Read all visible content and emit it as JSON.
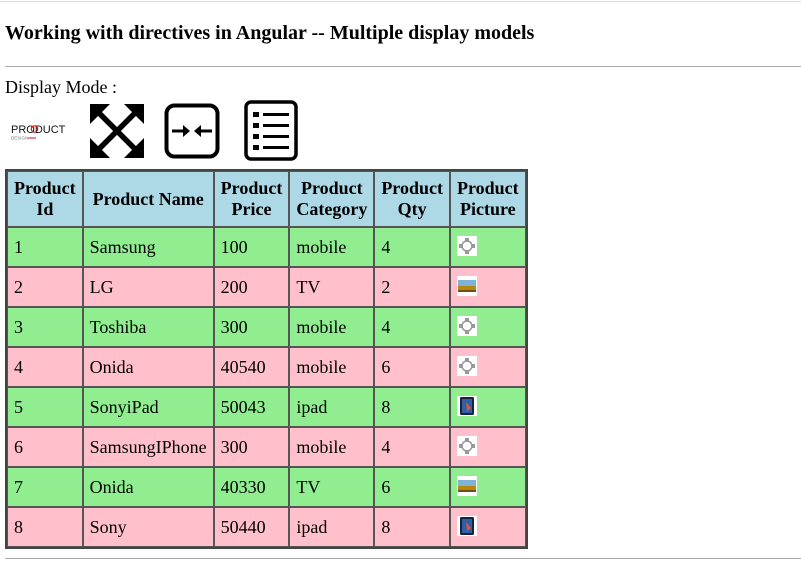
{
  "page": {
    "title": "Working with directives in Angular -- Multiple display models",
    "display_mode_label": "Display Mode :"
  },
  "display_modes": {
    "logo_text": "PRODUCT",
    "logo_subtext": "DESIGN",
    "items": [
      {
        "name": "product-logo",
        "icon": "product-logo"
      },
      {
        "name": "expand",
        "icon": "expand-arrows-icon"
      },
      {
        "name": "compress",
        "icon": "compress-arrows-icon"
      },
      {
        "name": "list",
        "icon": "list-icon"
      }
    ]
  },
  "table": {
    "headers": {
      "id": "Product Id",
      "name": "Product Name",
      "price": "Product Price",
      "category": "Product Category",
      "qty": "Product Qty",
      "picture": "Product Picture"
    },
    "rows": [
      {
        "id": "1",
        "name": "Samsung",
        "price": "100",
        "category": "mobile",
        "qty": "4",
        "picture": "phone-icon"
      },
      {
        "id": "2",
        "name": "LG",
        "price": "200",
        "category": "TV",
        "qty": "2",
        "picture": "tv-icon"
      },
      {
        "id": "3",
        "name": "Toshiba",
        "price": "300",
        "category": "mobile",
        "qty": "4",
        "picture": "phone-icon"
      },
      {
        "id": "4",
        "name": "Onida",
        "price": "40540",
        "category": "mobile",
        "qty": "6",
        "picture": "phone-icon"
      },
      {
        "id": "5",
        "name": "SonyiPad",
        "price": "50043",
        "category": "ipad",
        "qty": "8",
        "picture": "tablet-icon"
      },
      {
        "id": "6",
        "name": "SamsungIPhone",
        "price": "300",
        "category": "mobile",
        "qty": "4",
        "picture": "phone-icon"
      },
      {
        "id": "7",
        "name": "Onida",
        "price": "40330",
        "category": "TV",
        "qty": "6",
        "picture": "tv-icon"
      },
      {
        "id": "8",
        "name": "Sony",
        "price": "50440",
        "category": "ipad",
        "qty": "8",
        "picture": "tablet-icon"
      }
    ]
  },
  "colors": {
    "header_bg": "#add8e6",
    "row_even_bg": "#90ee90",
    "row_odd_bg": "#ffc0cb"
  }
}
